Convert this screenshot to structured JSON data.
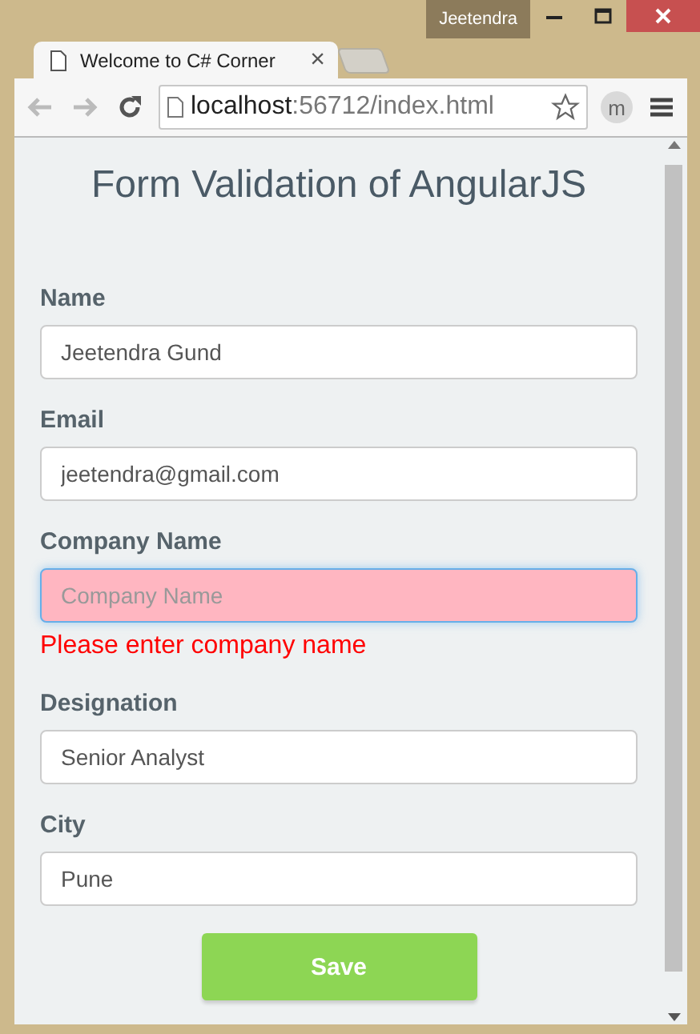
{
  "window": {
    "user": "Jeetendra"
  },
  "tabs": [
    {
      "title": "Welcome to C# Corner",
      "close": "×",
      "selected": true
    },
    {
      "kind": "new-tab",
      "selected": false
    }
  ],
  "address": {
    "host": "localhost",
    "path": ":56712/index.html",
    "profile": "m"
  },
  "page": {
    "heading": "Form Validation of AngularJS",
    "fields": [
      {
        "label": "Name",
        "value": "Jeetendra Gund",
        "invalid": false,
        "focused": false
      },
      {
        "label": "Email",
        "value": "jeetendra@gmail.com",
        "invalid": false,
        "focused": false
      },
      {
        "label": "Company Name",
        "placeholder": "Company Name",
        "invalid": true,
        "focused": true,
        "error": "Please enter company name"
      },
      {
        "label": "Designation",
        "value": "Senior Analyst",
        "invalid": false,
        "focused": false
      },
      {
        "label": "City",
        "value": "Pune",
        "invalid": false,
        "focused": false
      }
    ],
    "save": "Save"
  }
}
